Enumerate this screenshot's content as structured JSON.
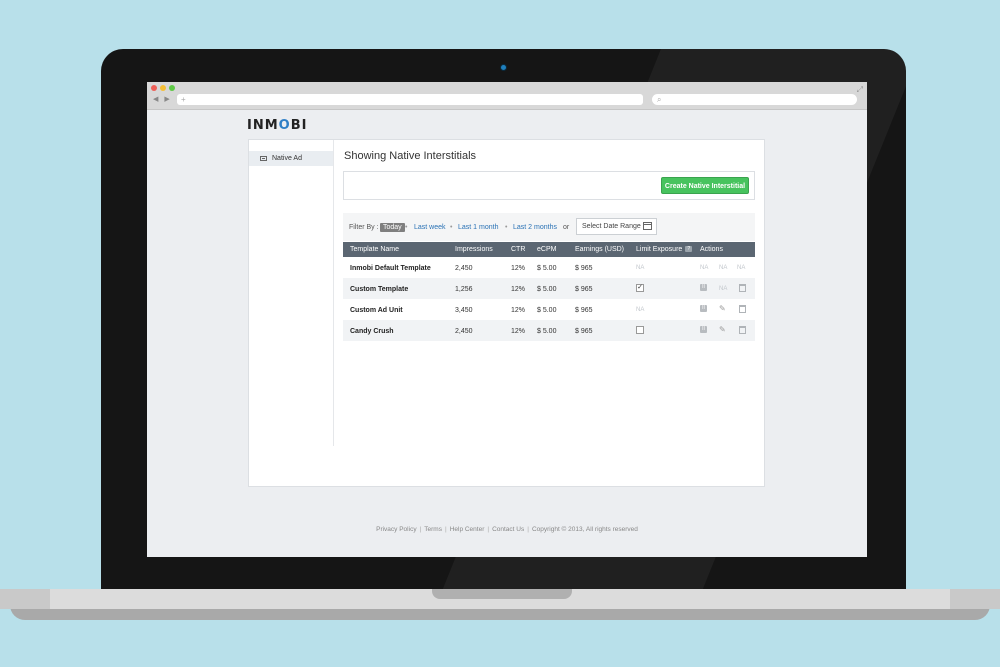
{
  "browser": {
    "nav_arrows": "◀ ▶",
    "url_placeholder": "+",
    "search_icon": "⌕"
  },
  "logo": {
    "pre": "INM",
    "o": "O",
    "post": "BI"
  },
  "sidebar": {
    "items": [
      {
        "label": "Native Ad",
        "icon": "native-ad-icon"
      }
    ]
  },
  "main": {
    "title": "Showing Native Interstitials",
    "create_button": "Create Native Interstitial"
  },
  "filter": {
    "label": "Filter By :",
    "today": "Today",
    "last_week": "Last week",
    "last_month": "Last 1 month",
    "last_2_months": "Last 2 months",
    "or": "or",
    "date_range": "Select Date Range",
    "sep": "•"
  },
  "table": {
    "headers": [
      "Template Name",
      "Impressions",
      "CTR",
      "eCPM",
      "Earnings (USD)",
      "Limit Exposure",
      "Actions"
    ],
    "rows": [
      {
        "name": "Inmobi Default Template",
        "impressions": "2,450",
        "ctr": "12%",
        "ecpm": "$ 5.00",
        "earnings": "$ 965",
        "limit": "NA",
        "a1": "NA",
        "a2": "NA",
        "a3": "NA"
      },
      {
        "name": "Custom Template",
        "impressions": "1,256",
        "ctr": "12%",
        "ecpm": "$ 5.00",
        "earnings": "$ 965",
        "limit": "checked",
        "a2": "NA"
      },
      {
        "name": "Custom Ad Unit",
        "impressions": "3,450",
        "ctr": "12%",
        "ecpm": "$ 5.00",
        "earnings": "$ 965",
        "limit": "NA"
      },
      {
        "name": "Candy Crush",
        "impressions": "2,450",
        "ctr": "12%",
        "ecpm": "$ 5.00",
        "earnings": "$ 965",
        "limit": "unchecked"
      }
    ]
  },
  "footer": {
    "privacy": "Privacy Policy",
    "terms": "Terms",
    "help": "Help Center",
    "contact": "Contact Us",
    "copyright": "Copyright © 2013, All rights reserved",
    "sep": "|"
  },
  "colors": {
    "accent": "#47c35e",
    "link": "#2a72b5",
    "header": "#5b6672",
    "background": "#b8e0ea"
  }
}
